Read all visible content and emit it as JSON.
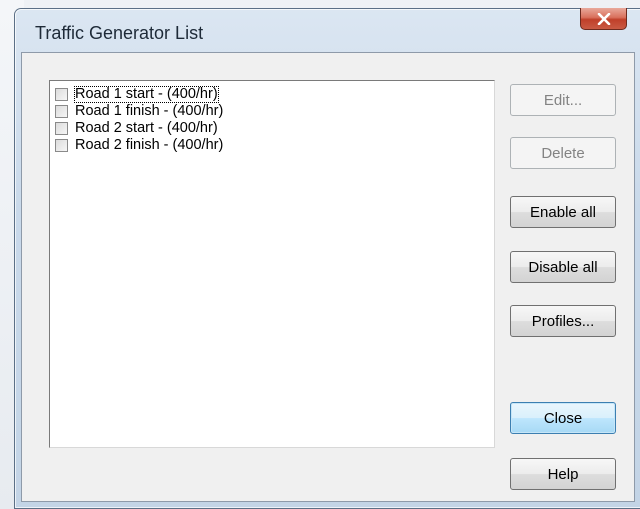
{
  "window": {
    "title": "Traffic Generator List",
    "close_icon": "close-icon"
  },
  "list": {
    "items": [
      {
        "label": "Road 1 start - (400/hr)",
        "checked": false
      },
      {
        "label": "Road 1 finish - (400/hr)",
        "checked": false
      },
      {
        "label": "Road 2 start - (400/hr)",
        "checked": false
      },
      {
        "label": "Road 2 finish - (400/hr)",
        "checked": false
      }
    ]
  },
  "buttons": {
    "edit": "Edit...",
    "delete": "Delete",
    "enable_all": "Enable all",
    "disable_all": "Disable all",
    "profiles": "Profiles...",
    "close": "Close",
    "help": "Help"
  },
  "colors": {
    "close_button": "#c95a43",
    "default_button_border": "#3c7fb1"
  }
}
